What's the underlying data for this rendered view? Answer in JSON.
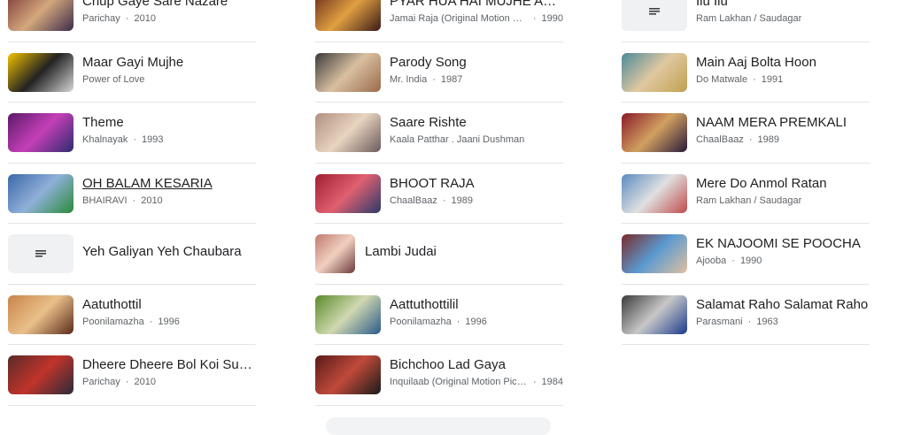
{
  "columns": [
    [
      {
        "title": "Chup Gaye Sare Nazare",
        "album": "Parichay",
        "year": "2010",
        "thumb": [
          "#7d3a3a",
          "#d4a87c",
          "#3b2b4a"
        ]
      },
      {
        "title": "Maar Gayi Mujhe",
        "album": "Power of Love",
        "year": "",
        "thumb": [
          "#f2c200",
          "#222222",
          "#d7d7d7"
        ]
      },
      {
        "title": "Theme",
        "album": "Khalnayak",
        "year": "1993",
        "thumb": [
          "#5a1a6a",
          "#c43fb6",
          "#2c2c6e"
        ]
      },
      {
        "title": "OH BALAM KESARIA",
        "album": "BHAIRAVI",
        "year": "2010",
        "link": true,
        "thumb": [
          "#3c67a8",
          "#8fb0d8",
          "#2a8a3a"
        ]
      },
      {
        "title": "Yeh Galiyan Yeh Chaubara",
        "album": "",
        "year": "",
        "placeholder": true
      },
      {
        "title": "Aatuthottil",
        "album": "Poonilamazha",
        "year": "1996",
        "thumb": [
          "#c9844a",
          "#e9c08a",
          "#5a2a1a"
        ]
      },
      {
        "title": "Dheere Dheere Bol Koi Sun…",
        "album": "Parichay",
        "year": "2010",
        "thumb": [
          "#5a2a2a",
          "#c0342a",
          "#2a2a3a"
        ]
      }
    ],
    [
      {
        "title": "PYAR HUA HAI MUJHE AU…",
        "album": "Jamai Raja (Original Motion Pi…",
        "year": "1990",
        "split": true,
        "thumb": [
          "#6a2a1a",
          "#e0a040",
          "#3a1a1a"
        ]
      },
      {
        "title": "Parody Song",
        "album": "Mr. India",
        "year": "1987",
        "thumb": [
          "#3a3a3a",
          "#d8c0a0",
          "#9a6a4a"
        ]
      },
      {
        "title": "Saare Rishte",
        "album": "Kaala Patthar . Jaani Dushman",
        "year": "",
        "thumb": [
          "#b09080",
          "#e8d4c0",
          "#6a5a5a"
        ]
      },
      {
        "title": "BHOOT RAJA",
        "album": "ChaalBaaz",
        "year": "1989",
        "thumb": [
          "#a02030",
          "#e06070",
          "#2a3a6a"
        ]
      },
      {
        "title": "Lambi Judai",
        "album": "",
        "year": "",
        "round": true,
        "thumb": [
          "#c07a70",
          "#f0d0c0",
          "#6a3a3a"
        ]
      },
      {
        "title": "Aattuthottilil",
        "album": "Poonilamazha",
        "year": "1996",
        "thumb": [
          "#5a8a2a",
          "#d0d8b0",
          "#2a5a8a"
        ]
      },
      {
        "title": "Bichchoo Lad Gaya",
        "album": "Inquilaab (Original Motion Pict…",
        "year": "1984",
        "split": true,
        "thumb": [
          "#5a1a1a",
          "#c04a3a",
          "#1a1a1a"
        ]
      }
    ],
    [
      {
        "title": "Ilu Ilu",
        "album": "Ram Lakhan / Saudagar",
        "year": "",
        "placeholder": true
      },
      {
        "title": "Main Aaj Bolta Hoon",
        "album": "Do Matwale",
        "year": "1991",
        "thumb": [
          "#4a8a9a",
          "#e0c8a0",
          "#c0a050"
        ]
      },
      {
        "title": "NAAM MERA PREMKALI",
        "album": "ChaalBaaz",
        "year": "1989",
        "thumb": [
          "#8a1a2a",
          "#d0a060",
          "#2a1a3a"
        ]
      },
      {
        "title": "Mere Do Anmol Ratan",
        "album": "Ram Lakhan / Saudagar",
        "year": "",
        "thumb": [
          "#5a8ac0",
          "#e0e0e0",
          "#c04a4a"
        ]
      },
      {
        "title": "EK NAJOOMI SE POOCHA",
        "album": "Ajooba",
        "year": "1990",
        "thumb": [
          "#7a2a2a",
          "#5a9ad0",
          "#e0c0a0"
        ]
      },
      {
        "title": "Salamat Raho Salamat Raho",
        "album": "Parasmani",
        "year": "1963",
        "thumb": [
          "#3a3a3a",
          "#c8c8c8",
          "#1a3a8a"
        ]
      }
    ]
  ]
}
